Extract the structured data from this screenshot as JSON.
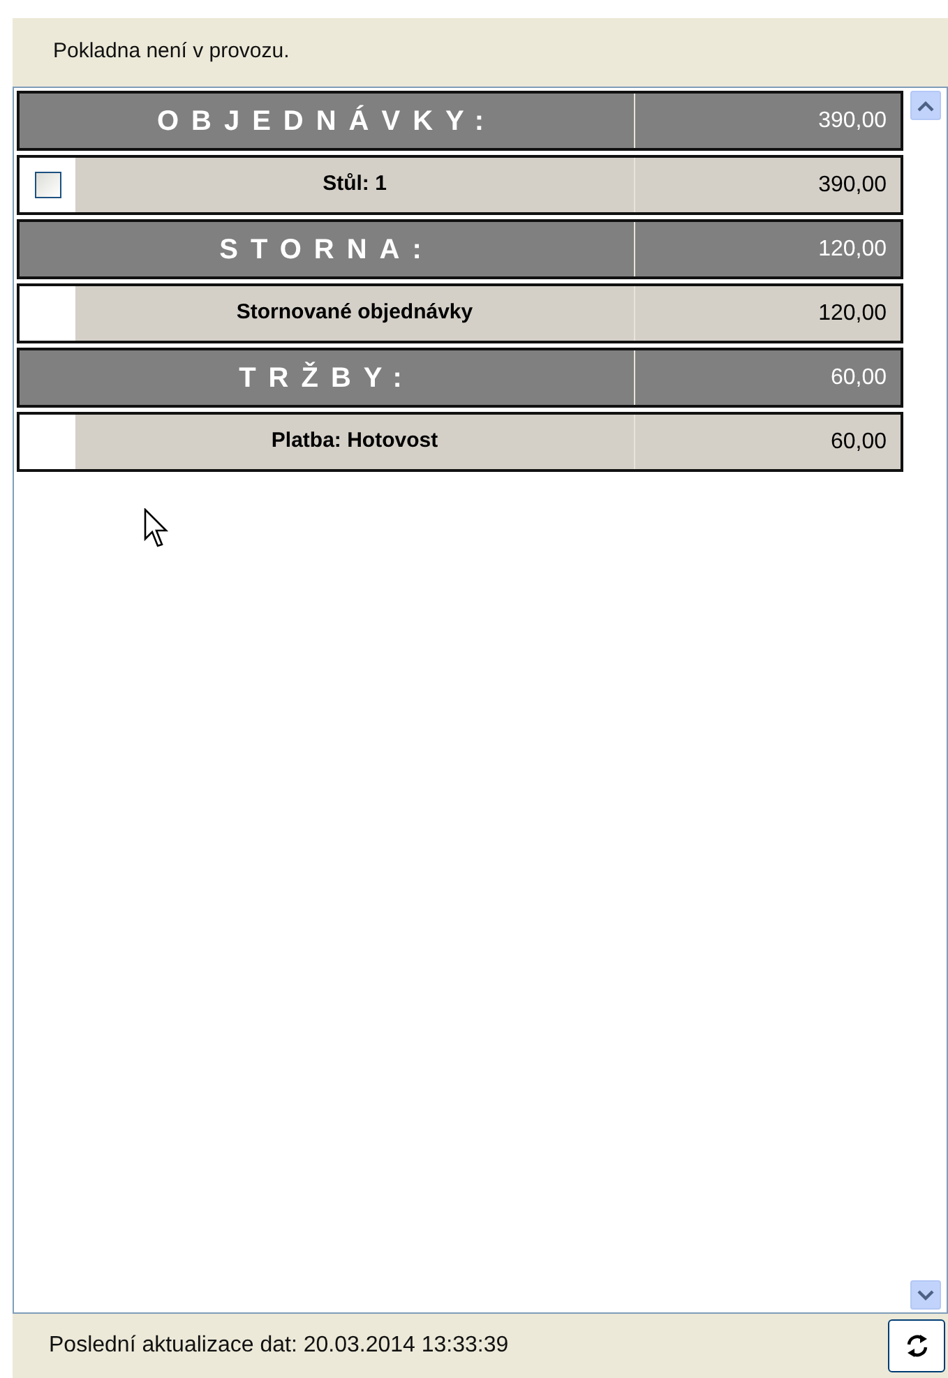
{
  "status_message": "Pokladna není v provozu.",
  "rows": [
    {
      "kind": "section",
      "label": "OBJEDNÁVKY:",
      "amount": "390,00"
    },
    {
      "kind": "item",
      "label": "Stůl: 1",
      "amount": "390,00",
      "checkbox": {
        "checked": false
      }
    },
    {
      "kind": "section",
      "label": "STORNA:",
      "amount": "120,00"
    },
    {
      "kind": "item",
      "label": "Stornované objednávky",
      "amount": "120,00"
    },
    {
      "kind": "section",
      "label": "TRŽBY:",
      "amount": "60,00"
    },
    {
      "kind": "item",
      "label": "Platba: Hotovost",
      "amount": "60,00"
    }
  ],
  "footer": {
    "last_update": "Poslední aktualizace dat: 20.03.2014 13:33:39"
  }
}
